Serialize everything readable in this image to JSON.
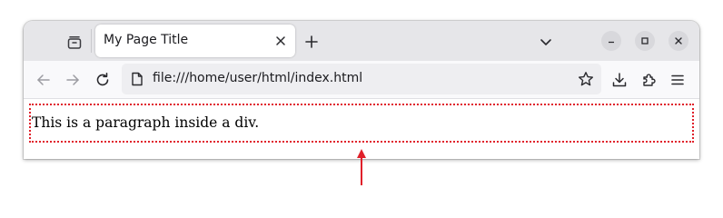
{
  "browser": {
    "tab": {
      "title": "My Page Title"
    },
    "address_bar": {
      "url": "file:///home/user/html/index.html"
    }
  },
  "page": {
    "paragraph_text": "This is a paragraph inside a div.",
    "div_border_color": "#e0202a"
  },
  "annotation": {
    "arrow_color": "#e0202a"
  },
  "icons": {
    "tab_group": "tab-group-icon",
    "tab_close": "close-icon",
    "new_tab": "plus-icon",
    "tab_list": "chevron-down-icon",
    "minimize": "minimize-icon",
    "maximize": "maximize-icon",
    "close_window": "close-icon",
    "back": "back-arrow-icon",
    "forward": "forward-arrow-icon",
    "reload": "reload-icon",
    "page": "page-icon",
    "bookmark": "star-icon",
    "downloads": "download-icon",
    "extensions": "puzzle-icon",
    "menu": "hamburger-menu-icon"
  }
}
